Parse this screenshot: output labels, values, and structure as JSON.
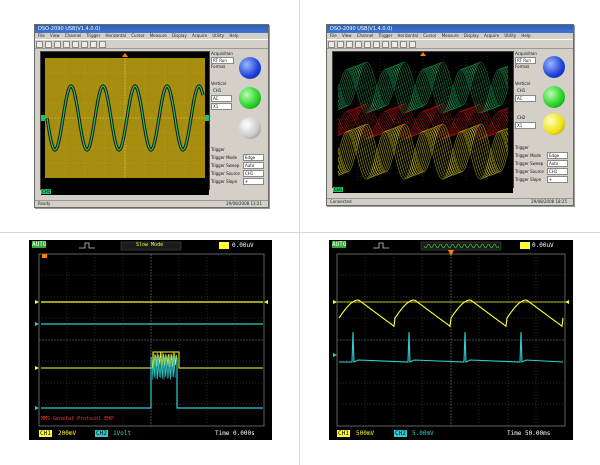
{
  "panels": {
    "tl": {
      "title": "DSO-2090 USB(V1.4.0.0)",
      "menu": [
        "File",
        "View",
        "Channel",
        "Trigger",
        "Horizontal",
        "Cursor",
        "Measure",
        "Display",
        "Acquire",
        "Utility",
        "Help"
      ],
      "right": {
        "acquisition": "Acquisition",
        "mode": "RT Run",
        "format_label": "Format",
        "vertical": "Vertical",
        "ch1": "CH1",
        "coupling": "AC",
        "probe": "X1",
        "trigger_label": "Trigger",
        "trigger_mode_label": "Trigger Mode",
        "trigger_mode": "Edge",
        "trigger_sweep_label": "Trigger Sweep",
        "trigger_sweep": "Auto",
        "trigger_source_label": "Trigger Source",
        "trigger_source": "CH1",
        "trigger_slope_label": "Trigger Slope",
        "trigger_slope": "+"
      },
      "status_left": "Ready",
      "status_right": "29/08/2008  13:21"
    },
    "tr": {
      "title": "DSO-2090 USB(V1.4.0.0)",
      "menu": [
        "File",
        "View",
        "Channel",
        "Trigger",
        "Horizontal",
        "Cursor",
        "Measure",
        "Display",
        "Acquire",
        "Utility",
        "Help"
      ],
      "right": {
        "acquisition": "Acquisition",
        "mode": "RT Run",
        "format_label": "Format",
        "vertical": "Vertical",
        "ch1": "CH1",
        "ch2": "CH2",
        "coupling": "AC",
        "probe": "X1",
        "trigger_label": "Trigger",
        "trigger_mode_label": "Trigger Mode",
        "trigger_mode": "Edge",
        "trigger_sweep_label": "Trigger Sweep",
        "trigger_sweep": "Auto",
        "trigger_source_label": "Trigger Source",
        "trigger_source": "CH1",
        "trigger_slope_label": "Trigger Slope",
        "trigger_slope": "+"
      },
      "status_left": "Connected",
      "status_right": "29/08/2008  18:25"
    },
    "bl": {
      "top_mode": "AUTO",
      "mid": "Slow Mode",
      "top_right": "0.00uV",
      "ch1_label": "CH1",
      "ch1_val": "200mV",
      "ch2_label": "CH2",
      "ch2_val": "1Volt",
      "time": "Time  0.000s",
      "note": "MMS General Protocol EHP"
    },
    "br": {
      "top_mode": "AUTO",
      "top_right": "0.00uV",
      "ch1_label": "CH1",
      "ch1_val": "500mV",
      "ch2_label": "CH2",
      "ch2_val": "5.00mV",
      "time": "Time  50.00ms"
    }
  },
  "colors": {
    "ch1": "#ffff33",
    "ch2": "#33cccc",
    "win_blue": "#2d5fb5",
    "scope_gold": "#a08a10",
    "green_wave": "#22c066",
    "red_wave": "#d01818"
  }
}
